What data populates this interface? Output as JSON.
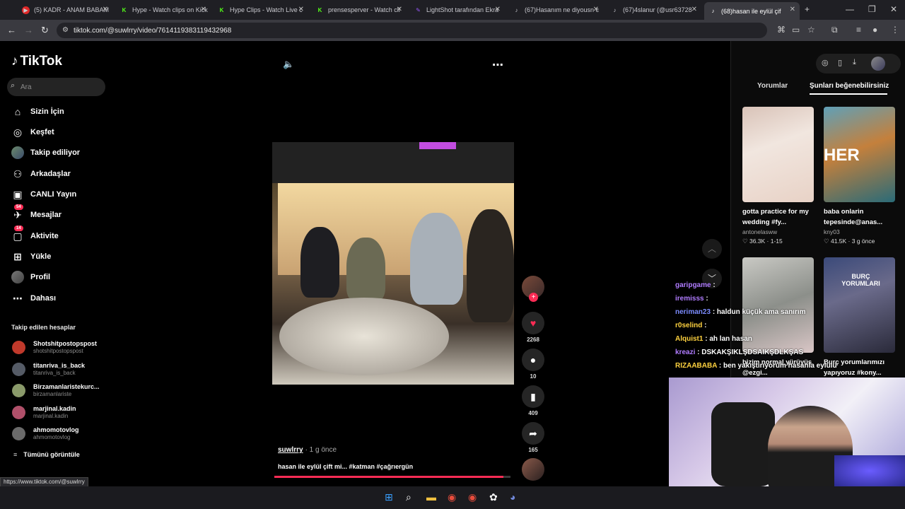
{
  "browser": {
    "tabs": [
      {
        "title": "(5) KADR - ANAM BABAM",
        "color": "#e02828"
      },
      {
        "title": "Hype - Watch clips on Kick",
        "color": "#53fc18"
      },
      {
        "title": "Hype Clips - Watch Live c",
        "color": "#53fc18"
      },
      {
        "title": "prensesperver - Watch cli",
        "color": "#53fc18"
      },
      {
        "title": "LightShot tarafından Ekra",
        "color": "#9b59ff"
      },
      {
        "title": "(67)Hasanım ne diyousn c",
        "color": "#000000"
      },
      {
        "title": "(67)4slanur (@usr63728",
        "color": "#000000"
      },
      {
        "title": "(68)hasan ile eylül çif",
        "color": "#000000"
      }
    ],
    "url": "tiktok.com/@suwlrry/video/7614119383119432968",
    "status_url": "https://www.tiktok.com/@suwlrry"
  },
  "sidebar": {
    "logo": "TikTok",
    "search_placeholder": "Ara",
    "nav": [
      {
        "label": "Sizin İçin",
        "icon": "home-icon"
      },
      {
        "label": "Keşfet",
        "icon": "compass-icon"
      },
      {
        "label": "Takip ediliyor",
        "icon": "avatar"
      },
      {
        "label": "Arkadaşlar",
        "icon": "friends-icon"
      },
      {
        "label": "CANLI Yayın",
        "icon": "live-icon"
      },
      {
        "label": "Mesajlar",
        "icon": "messages-icon",
        "badge": "54"
      },
      {
        "label": "Aktivite",
        "icon": "activity-icon",
        "badge": "14"
      },
      {
        "label": "Yükle",
        "icon": "upload-icon"
      },
      {
        "label": "Profil",
        "icon": "profile-avatar"
      },
      {
        "label": "Dahası",
        "icon": "more-icon"
      }
    ],
    "following_header": "Takip edilen hesaplar",
    "following": [
      {
        "name": "Shotshitpostopspost",
        "handle": "shotshitpostopspost",
        "color": "#c0392b"
      },
      {
        "name": "titanriva_is_back",
        "handle": "titanriva_is_back",
        "color": "#555b66"
      },
      {
        "name": "Birzamanlaristekurc...",
        "handle": "birzamanlariste",
        "color": "#8a9a6a"
      },
      {
        "name": "marjinal.kadin",
        "handle": "marjinal.kadin",
        "color": "#b0506a"
      },
      {
        "name": "ahmomotovlog",
        "handle": "ahmomotovlog",
        "color": "#6a6a6a"
      }
    ],
    "see_all": "Tümünü görüntüle"
  },
  "video": {
    "author": "suwlrry",
    "time": "· 1 g önce",
    "caption": "hasan ile eylül çift mi... #katman #çağrıergün",
    "likes": "2268",
    "comments": "10",
    "saves": "409",
    "shares": "165",
    "progress": 0.97
  },
  "right": {
    "tab_comments": "Yorumlar",
    "tab_suggest": "Şunları beğenebilirsiniz",
    "cards": [
      {
        "caption": "gotta practice for my wedding #fy...",
        "author": "antonelasww",
        "stats": "♡ 36.3K · 1-15",
        "thumb": "linear-gradient(160deg,#d9c3b8 0%,#f1e6df 40%,#e8d2c6 100%)"
      },
      {
        "caption": "baba onlarin tepesinde@anas...",
        "author": "kny03",
        "stats": "♡ 41.5K · 3 g önce",
        "thumb": "linear-gradient(160deg,#5fa0b8 0%,#c4803c 45%,#2a6b78 100%)",
        "overlay": "HER"
      },
      {
        "caption": "bizim normal yürüyüş @ezgi...",
        "author": "",
        "stats": "",
        "thumb": "linear-gradient(160deg,#c9c9c4 0%,#8c8f8a 50%,#d9c6c6 100%)"
      },
      {
        "caption": "Burç yorumlarımızı yapıyoruz #kony...",
        "author": "",
        "stats": "",
        "thumb": "linear-gradient(160deg,#3b4a7a 0%,#6a6a8a 40%,#2a2a3a 100%)",
        "overlay": "BURÇ YORUMLARI"
      }
    ]
  },
  "chat": [
    {
      "user": "garipgame",
      "msg": ":",
      "color": "#b07cff"
    },
    {
      "user": "iremisss",
      "msg": ":",
      "color": "#b07cff"
    },
    {
      "user": "neriman23",
      "msg": ": haldun küçük ama sanırım",
      "color": "#7c8cff"
    },
    {
      "user": "r0selind",
      "msg": ":",
      "color": "#ffd23f"
    },
    {
      "user": "Alquist1",
      "msg": ": ah lan hasan",
      "color": "#ffd23f"
    },
    {
      "user": "kreazi",
      "msg": ": DSKAKŞIKLŞDSAIKŞDLKŞAS",
      "color": "#b07cff"
    },
    {
      "user": "RIZAABABA",
      "msg": ": ben yakıştırıyorum hasanla eylülü",
      "color": "#ffd23f"
    }
  ]
}
